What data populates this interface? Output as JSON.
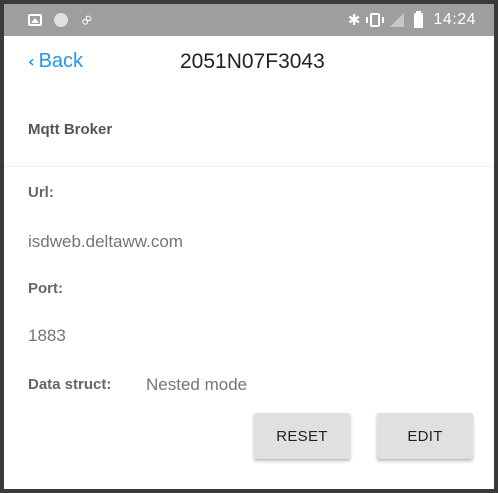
{
  "status_bar": {
    "time": "14:24",
    "left_icons": [
      "image-icon",
      "circle-icon",
      "link-icon"
    ],
    "right_icons": [
      "bluetooth-icon",
      "vibrate-icon",
      "signal-icon",
      "battery-icon"
    ]
  },
  "header": {
    "back_label": "Back",
    "title": "2051N07F3043",
    "accent_color": "#2196f3"
  },
  "section": {
    "title": "Mqtt Broker"
  },
  "fields": {
    "url_label": "Url:",
    "url_value": "isdweb.deltaww.com",
    "port_label": "Port:",
    "port_value": "1883",
    "data_struct_label": "Data struct:",
    "data_struct_value": "Nested mode"
  },
  "actions": {
    "reset_label": "RESET",
    "edit_label": "EDIT"
  }
}
